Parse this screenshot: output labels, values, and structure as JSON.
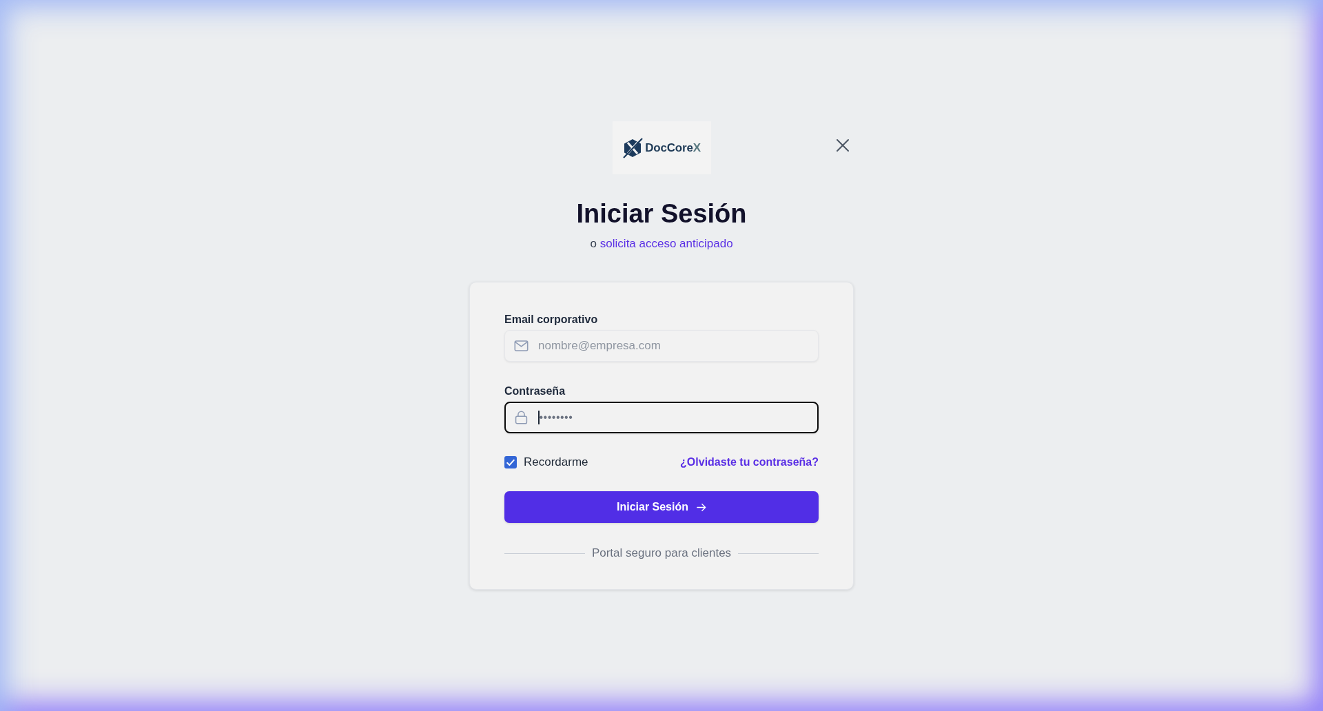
{
  "logo": {
    "wordmark": "DocCore",
    "wordmark_accent": "X"
  },
  "heading": "Iniciar Sesión",
  "subtitle": {
    "prefix": "o",
    "link": "solicita acceso anticipado"
  },
  "form": {
    "fields": [
      {
        "kind": "email",
        "label": "Email corporativo",
        "placeholder": "nombre@empresa.com",
        "focused": false
      },
      {
        "kind": "password",
        "label": "Contraseña",
        "value": "••••••••",
        "focused": true
      }
    ],
    "remember": {
      "label": "Recordarme",
      "checked": true
    },
    "forgot_link": "¿Olvidaste tu contraseña?",
    "submit": {
      "label": "Iniciar Sesión"
    },
    "footer_note": "Portal seguro para clientes"
  }
}
